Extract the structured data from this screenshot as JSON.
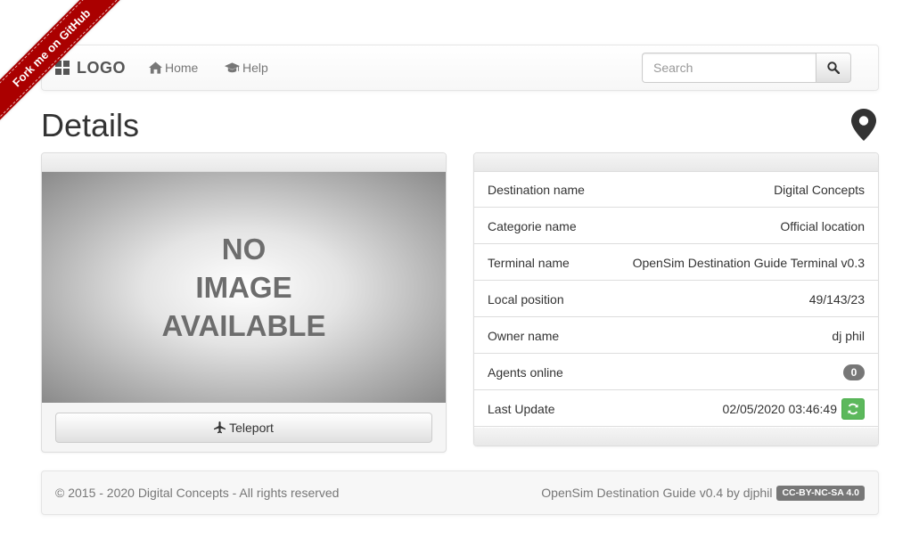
{
  "ribbon": {
    "label": "Fork me on GitHub"
  },
  "navbar": {
    "brand": "LOGO",
    "links": [
      {
        "label": "Home",
        "icon": "home-icon"
      },
      {
        "label": "Help",
        "icon": "graduation-cap-icon"
      }
    ],
    "search": {
      "placeholder": "Search",
      "value": "",
      "icon": "search-icon"
    }
  },
  "page": {
    "title": "Details",
    "title_icon": "map-marker-icon"
  },
  "image_panel": {
    "placeholder_lines": [
      "NO",
      "IMAGE",
      "AVAILABLE"
    ],
    "teleport_label": "Teleport",
    "teleport_icon": "plane-icon"
  },
  "details": {
    "rows": [
      {
        "label": "Destination name",
        "value": "Digital Concepts"
      },
      {
        "label": "Categorie name",
        "value": "Official location"
      },
      {
        "label": "Terminal name",
        "value": "OpenSim Destination Guide Terminal v0.3"
      },
      {
        "label": "Local position",
        "value": "49/143/23"
      },
      {
        "label": "Owner name",
        "value": "dj phil"
      },
      {
        "label": "Agents online",
        "value": "0"
      },
      {
        "label": "Last Update",
        "value": "02/05/2020 03:46:49"
      }
    ],
    "colors": {
      "badge": "#777777",
      "refresh": "#5cb85c"
    }
  },
  "footer": {
    "copyright": "© 2015 - 2020 Digital Concepts - All rights reserved",
    "credit": "OpenSim Destination Guide v0.4 by djphil",
    "license": "CC-BY-NC-SA 4.0"
  },
  "colors": {
    "ribbon": "#aa0000",
    "text": "#333333",
    "muted": "#777777"
  }
}
